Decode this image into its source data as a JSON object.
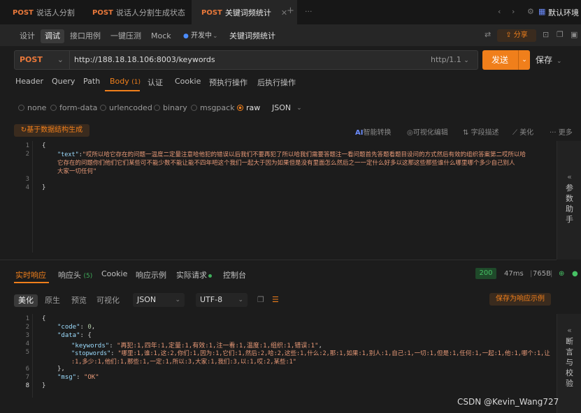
{
  "tabs": [
    {
      "method": "POST",
      "label": "说话人分割"
    },
    {
      "method": "POST",
      "label": "说话人分割生成状态"
    },
    {
      "method": "POST",
      "label": "关键词频统计",
      "active": true
    }
  ],
  "top_right": {
    "env_label": "默认环境",
    "add": "+"
  },
  "subbar": {
    "segments": [
      "设计",
      "调试",
      "接口用例",
      "一键压测",
      "Mock"
    ],
    "status": "开发中",
    "title": "关键词频统计",
    "share": "分享"
  },
  "request": {
    "method": "POST",
    "url": "http://188.18.18.106:8003/keywords",
    "protocol": "http/1.1",
    "send": "发送",
    "save": "保存"
  },
  "req_tabs": [
    {
      "label": "Header"
    },
    {
      "label": "Query"
    },
    {
      "label": "Path"
    },
    {
      "label": "Body",
      "count": "(1)",
      "active": true
    },
    {
      "label": "认证"
    },
    {
      "label": "Cookie"
    },
    {
      "label": "预执行操作"
    },
    {
      "label": "后执行操作"
    }
  ],
  "body_types": [
    "none",
    "form-data",
    "urlencoded",
    "binary",
    "msgpack",
    "raw",
    "JSON"
  ],
  "body_selected": "raw",
  "editor_tools": {
    "generate": "基于数据结构生成",
    "ai": "AI",
    "ai_label": "智能转换",
    "visual": "可视化编辑",
    "field": "字段描述",
    "beautify": "美化",
    "more": "更多"
  },
  "request_body": {
    "line_numbers": [
      "1",
      "2",
      "3",
      "4"
    ],
    "open": "{",
    "key": "\"text\"",
    "colon": ":",
    "value_l1": "\"哎所以哈它存在的问题一温度二定量注意哈他犯的错误以后我们不要再犯了所以哈我们需要答题注一看问题首先答题看题目设问的方式然后有效的组织答案第二哎所以哈",
    "value_l2": "它存在的问题你们他们它们某些可不能少数不能让能不四年吧这个我们一起大于因为如果但是没有里面怎么然后之一一定什么好多以这那这些那些谁什么哪里哪个多少自己别人",
    "value_l3": "大家一切任何\"",
    "close": "}"
  },
  "side_panels": {
    "params": "参数助手",
    "assert": "断言与校验",
    "chevron": "«"
  },
  "resp_tabs": [
    {
      "label": "实时响应",
      "active": true
    },
    {
      "label": "响应头",
      "count": "(5)"
    },
    {
      "label": "Cookie"
    },
    {
      "label": "响应示例"
    },
    {
      "label": "实际请求",
      "dot": true
    },
    {
      "label": "控制台"
    }
  ],
  "resp_meta": {
    "status": "200",
    "time": "47ms",
    "size": "765B"
  },
  "view_tabs": [
    "美化",
    "原生",
    "预览",
    "可视化"
  ],
  "format_select": "JSON",
  "encoding_select": "UTF-8",
  "save_example": "保存为响应示例",
  "response": {
    "line_numbers": [
      "1",
      "2",
      "3",
      "4",
      "5",
      "",
      "6",
      "7",
      "8"
    ],
    "code_key": "\"code\"",
    "code_val": "0",
    "data_key": "\"data\"",
    "keywords_key": "\"keywords\"",
    "keywords_val": "\"再犯:1,四年:1,定量:1,有效:1,注一看:1,温度:1,组织:1,错误:1\"",
    "stopwords_key": "\"stopwords\"",
    "stopwords_val_l1": "\"哪里:1,谁:1,这:2,你们:1,因为:1,它们:1,然后:2,哈:2,这些:1,什么:2,那:1,如果:1,别人:1,自己:1,一切:1,但是:1,任何:1,一起:1,他:1,哪个:1,让",
    "stopwords_val_l2": ":1,多少:1,他们:1,那些:1,一定:1,所以:3,大家:1,我们:3,以:1,哎:2,某些:1\"",
    "msg_key": "\"msg\"",
    "msg_val": "\"OK\""
  },
  "watermark": "CSDN @Kevin_Wang727"
}
